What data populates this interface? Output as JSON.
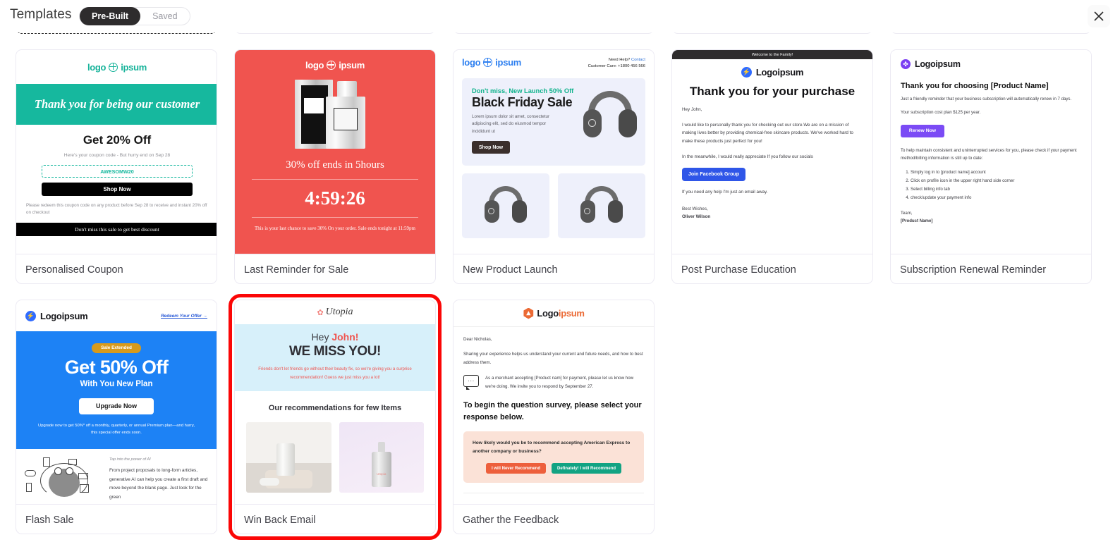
{
  "header": {
    "title": "Templates",
    "toggle": {
      "options": [
        "Pre-Built",
        "Saved"
      ],
      "selected": "Pre-Built"
    },
    "close_icon": "close-icon"
  },
  "cards": [
    {
      "label": "Personalised Coupon",
      "brand": "logo",
      "brand2": "ipsum",
      "band": "Thank you for being our customer",
      "heading": "Get 20% Off",
      "sub": "Here's your coupon code - But hurry end on  Sep 28",
      "code": "AWESOMW20",
      "button": "Shop Now",
      "note": "Please redeem this coupon code on any product before Sep 28 to receive and instant 20% off on checkout",
      "footer": "Don't miss this sale to get best discount"
    },
    {
      "label": "Last Reminder for Sale",
      "brand": "logo",
      "brand2": "ipsum",
      "offer": "30% off ends in 5hours",
      "timer": "4:59:26",
      "note": "This is your last chance to save 30% On your order. Sale ends tonight at 11:59pm"
    },
    {
      "label": "New Product Launch",
      "brand": "logo",
      "brand2": "ipsum",
      "help": "Need Help?",
      "help_link": "Contact",
      "care": "Customer Care: +1800 456 566",
      "kicker": "Don't miss, New Launch 50% Off",
      "heading": "Black Friday Sale",
      "body": "Lorem ipsum dolor sit amet, consectetur adipiscing elit, sed do eiusmod tempor incididunt ut",
      "button": "Shop Now"
    },
    {
      "label": "Post Purchase Education",
      "banner": "Welcome to the Family!",
      "brand": "Logoipsum",
      "heading": "Thank you for your purchase",
      "greeting": "Hey John,",
      "p1": "I would like to personally thank you for checking out our store.We are on a mission of making lives better by providing chemical-free skincare products. We've worked hard to make these products just perfect for you!",
      "p2": "In the meanwhile, I would really appreciate If you follow our socials",
      "button": "Join Facebook Group",
      "p3": "If you need any help I'm just an email away.",
      "sign1": "Best Wishes,",
      "sign2": "Oliver Wilson"
    },
    {
      "label": "Subscription Renewal Reminder",
      "brand": "Logoipsum",
      "heading": "Thank you for choosing [Product Name]",
      "p1": "Just a friendly reminder that your business subscription will automatically renew in 7 days.",
      "p2": "Your subscription cost plan $125 per year.",
      "button": "Renew Now",
      "p3": "To help maintain consistent and uninterrupted services for you, please check if your payment method/billing information is still up to date:",
      "list": [
        "Simply log in to [product name] account",
        "Click on profile icon in the upper right hand side corner",
        "Select billing info tab",
        "check/update your payment info"
      ],
      "sign1": "Team,",
      "sign2": "[Product Name]"
    },
    {
      "label": "Flash Sale",
      "brand": "Logoipsum",
      "link": "Redeem Your Offer →",
      "pill": "Sale Extended",
      "heading": "Get 50% Off",
      "sub": "With You New Plan",
      "button": "Upgrade Now",
      "note": "Upgrade now to get 50%* off a monthly, quarterly, or annual Premium plan—and hurry, this special offer ends soon.",
      "ai_title": "Tap into the power of AI",
      "ai_body": "From project proposals to long-form articles, generative AI can help you create a first draft and move beyond the blank page. Just look for the green"
    },
    {
      "label": "Win Back Email",
      "brand": "Utopia",
      "hey": "Hey ",
      "hey_name": "John!",
      "miss": "WE MISS YOU!",
      "body_a": "Friends don't let friends go without their beauty fix, so we're giving you a ",
      "body_hl": "surprise recommendation!",
      "body_b": " Guess we just miss you a lot!",
      "rec_title": "Our recommendations for few Items",
      "item2_label": "Utopia",
      "selected": true
    },
    {
      "label": "Gather the Feedback",
      "brand": "Logo",
      "brand2": "ipsum",
      "greeting": "Dear Nicholas,",
      "p1": "Sharing your experience helps us understand your current and future needs, and how to best address them.",
      "p2": "As a merchant accepting [Product nam] for payment, please let us know how we're doing. We invite you to respond by September 27.",
      "heading": "To begin the question survey, please select your response below.",
      "question": "How likely would you be to recommend accepting American Express to another company or business?",
      "btn_no": "I will Never Recommend",
      "btn_yes": "Definately! I will Recommend"
    }
  ],
  "colors": {
    "accent_selected": "#fb0606",
    "teal": "#16b89e",
    "coral": "#f0544f",
    "blue": "#1d82f5",
    "purple": "#7b4bf5",
    "orange": "#eb6a35"
  }
}
